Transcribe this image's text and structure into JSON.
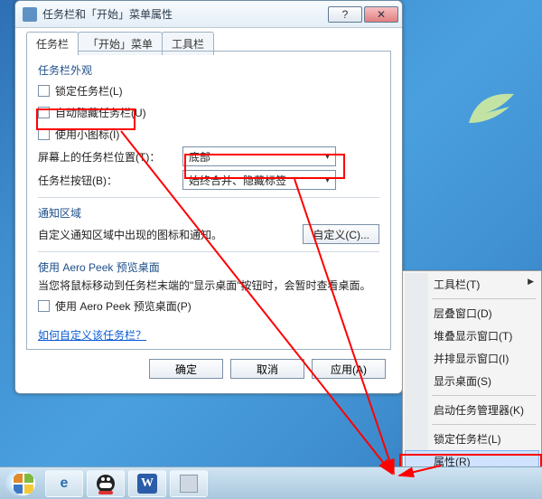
{
  "dialog": {
    "title": "任务栏和「开始」菜单属性",
    "tabs": {
      "taskbar": "任务栏",
      "startmenu": "「开始」菜单",
      "toolbars": "工具栏"
    },
    "appearance": {
      "heading": "任务栏外观",
      "lock": "锁定任务栏(L)",
      "autohide": "自动隐藏任务栏(U)",
      "smallicons": "使用小图标(I)",
      "position_label": "屏幕上的任务栏位置(T)：",
      "position_value": "底部",
      "buttons_label": "任务栏按钮(B)：",
      "buttons_value": "始终合并、隐藏标签"
    },
    "notify": {
      "heading": "通知区域",
      "text": "自定义通知区域中出现的图标和通知。",
      "customize_btn": "自定义(C)..."
    },
    "aero": {
      "heading": "使用 Aero Peek 预览桌面",
      "text": "当您将鼠标移动到任务栏末端的\"显示桌面\"按钮时，会暂时查看桌面。",
      "checkbox": "使用 Aero Peek 预览桌面(P)"
    },
    "link": "如何自定义该任务栏？",
    "buttons": {
      "ok": "确定",
      "cancel": "取消",
      "apply": "应用(A)"
    }
  },
  "contextmenu": {
    "toolbars": "工具栏(T)",
    "cascade": "层叠窗口(D)",
    "stacked": "堆叠显示窗口(T)",
    "sidebyside": "并排显示窗口(I)",
    "showdesktop": "显示桌面(S)",
    "taskmgr": "启动任务管理器(K)",
    "lock": "锁定任务栏(L)",
    "properties": "属性(R)"
  },
  "taskbar_icons": {
    "ie": "e",
    "word": "W"
  }
}
